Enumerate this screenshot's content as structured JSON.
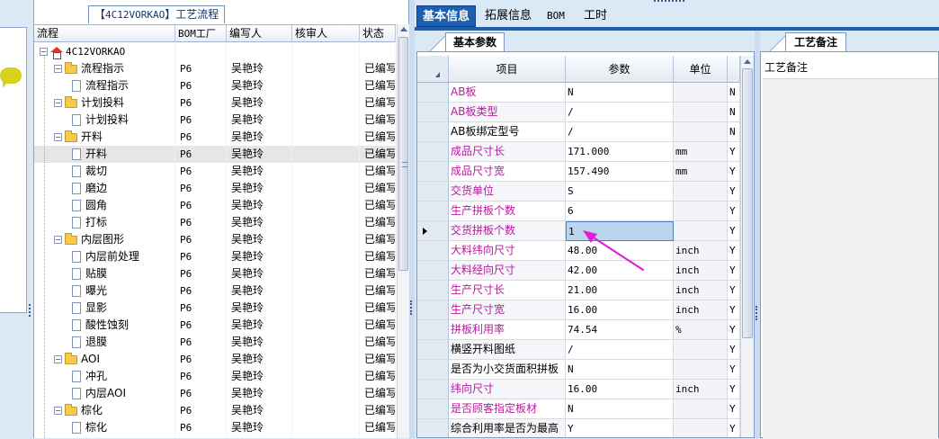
{
  "tree": {
    "title_prefix": "【",
    "title_code": "4C12VORKAO",
    "title_suffix": "】工艺流程",
    "headers": [
      "流程",
      "BOM工厂",
      "编写人",
      "核审人",
      "状态"
    ],
    "rows": [
      {
        "name": "4C12VORKAO",
        "level": 0,
        "kind": "root",
        "factory": "",
        "author": "",
        "reviewer": "",
        "status": ""
      },
      {
        "name": "流程指示",
        "level": 1,
        "kind": "folder",
        "factory": "P6",
        "author": "吴艳玲",
        "reviewer": "",
        "status": "已编写"
      },
      {
        "name": "流程指示",
        "level": 2,
        "kind": "doc",
        "factory": "P6",
        "author": "吴艳玲",
        "reviewer": "",
        "status": "已编写"
      },
      {
        "name": "计划投料",
        "level": 1,
        "kind": "folder",
        "factory": "P6",
        "author": "吴艳玲",
        "reviewer": "",
        "status": "已编写"
      },
      {
        "name": "计划投料",
        "level": 2,
        "kind": "doc",
        "factory": "P6",
        "author": "吴艳玲",
        "reviewer": "",
        "status": "已编写"
      },
      {
        "name": "开料",
        "level": 1,
        "kind": "folder",
        "factory": "P6",
        "author": "吴艳玲",
        "reviewer": "",
        "status": "已编写"
      },
      {
        "name": "开料",
        "level": 2,
        "kind": "doc",
        "factory": "P6",
        "author": "吴艳玲",
        "reviewer": "",
        "status": "已编写",
        "selected": true
      },
      {
        "name": "裁切",
        "level": 2,
        "kind": "doc",
        "factory": "P6",
        "author": "吴艳玲",
        "reviewer": "",
        "status": "已编写"
      },
      {
        "name": "磨边",
        "level": 2,
        "kind": "doc",
        "factory": "P6",
        "author": "吴艳玲",
        "reviewer": "",
        "status": "已编写"
      },
      {
        "name": "圆角",
        "level": 2,
        "kind": "doc",
        "factory": "P6",
        "author": "吴艳玲",
        "reviewer": "",
        "status": "已编写"
      },
      {
        "name": "打标",
        "level": 2,
        "kind": "doc",
        "factory": "P6",
        "author": "吴艳玲",
        "reviewer": "",
        "status": "已编写"
      },
      {
        "name": "内层图形",
        "level": 1,
        "kind": "folder",
        "factory": "P6",
        "author": "吴艳玲",
        "reviewer": "",
        "status": "已编写"
      },
      {
        "name": "内层前处理",
        "level": 2,
        "kind": "doc",
        "factory": "P6",
        "author": "吴艳玲",
        "reviewer": "",
        "status": "已编写"
      },
      {
        "name": "贴膜",
        "level": 2,
        "kind": "doc",
        "factory": "P6",
        "author": "吴艳玲",
        "reviewer": "",
        "status": "已编写"
      },
      {
        "name": "曝光",
        "level": 2,
        "kind": "doc",
        "factory": "P6",
        "author": "吴艳玲",
        "reviewer": "",
        "status": "已编写"
      },
      {
        "name": "显影",
        "level": 2,
        "kind": "doc",
        "factory": "P6",
        "author": "吴艳玲",
        "reviewer": "",
        "status": "已编写"
      },
      {
        "name": "酸性蚀刻",
        "level": 2,
        "kind": "doc",
        "factory": "P6",
        "author": "吴艳玲",
        "reviewer": "",
        "status": "已编写"
      },
      {
        "name": "退膜",
        "level": 2,
        "kind": "doc",
        "factory": "P6",
        "author": "吴艳玲",
        "reviewer": "",
        "status": "已编写"
      },
      {
        "name": "AOI",
        "level": 1,
        "kind": "folder",
        "factory": "P6",
        "author": "吴艳玲",
        "reviewer": "",
        "status": "已编写"
      },
      {
        "name": "冲孔",
        "level": 2,
        "kind": "doc",
        "factory": "P6",
        "author": "吴艳玲",
        "reviewer": "",
        "status": "已编写"
      },
      {
        "name": "内层AOI",
        "level": 2,
        "kind": "doc",
        "factory": "P6",
        "author": "吴艳玲",
        "reviewer": "",
        "status": "已编写"
      },
      {
        "name": "棕化",
        "level": 1,
        "kind": "folder",
        "factory": "P6",
        "author": "吴艳玲",
        "reviewer": "",
        "status": "已编写"
      },
      {
        "name": "棕化",
        "level": 2,
        "kind": "doc",
        "factory": "P6",
        "author": "吴艳玲",
        "reviewer": "",
        "status": "已编写"
      }
    ]
  },
  "top_tabs": [
    {
      "label": "基本信息",
      "active": true
    },
    {
      "label": "拓展信息",
      "active": false
    },
    {
      "label": "BOM",
      "active": false
    },
    {
      "label": "工时",
      "active": false
    }
  ],
  "params": {
    "tab_label": "基本参数",
    "headers": {
      "item": "项目",
      "param": "参数",
      "unit": "单位"
    },
    "rows": [
      {
        "item": "AB板",
        "value": "N",
        "unit": "",
        "flag": "N",
        "color": "magenta"
      },
      {
        "item": "AB板类型",
        "value": "/",
        "unit": "",
        "flag": "N",
        "color": "magenta"
      },
      {
        "item": "AB板绑定型号",
        "value": "/",
        "unit": "",
        "flag": "N",
        "color": "black"
      },
      {
        "item": "成品尺寸长",
        "value": "171.000",
        "unit": "mm",
        "flag": "Y",
        "color": "magenta"
      },
      {
        "item": "成品尺寸宽",
        "value": "157.490",
        "unit": "mm",
        "flag": "Y",
        "color": "magenta"
      },
      {
        "item": "交货单位",
        "value": "S",
        "unit": "",
        "flag": "Y",
        "color": "magenta"
      },
      {
        "item": "生产拼板个数",
        "value": "6",
        "unit": "",
        "flag": "Y",
        "color": "magenta"
      },
      {
        "item": "交货拼板个数",
        "value": "1",
        "unit": "",
        "flag": "Y",
        "color": "magenta",
        "current": true
      },
      {
        "item": "大料纬向尺寸",
        "value": "48.00",
        "unit": "inch",
        "flag": "Y",
        "color": "magenta"
      },
      {
        "item": "大料经向尺寸",
        "value": "42.00",
        "unit": "inch",
        "flag": "Y",
        "color": "magenta"
      },
      {
        "item": "生产尺寸长",
        "value": "21.00",
        "unit": "inch",
        "flag": "Y",
        "color": "magenta"
      },
      {
        "item": "生产尺寸宽",
        "value": "16.00",
        "unit": "inch",
        "flag": "Y",
        "color": "magenta"
      },
      {
        "item": "拼板利用率",
        "value": "74.54",
        "unit": "%",
        "flag": "Y",
        "color": "magenta"
      },
      {
        "item": "横竖开料图纸",
        "value": "/",
        "unit": "",
        "flag": "Y",
        "color": "black"
      },
      {
        "item": "是否为小交货面积拼板",
        "value": "N",
        "unit": "",
        "flag": "Y",
        "color": "black"
      },
      {
        "item": "纬向尺寸",
        "value": "16.00",
        "unit": "inch",
        "flag": "Y",
        "color": "magenta"
      },
      {
        "item": "是否顾客指定板材",
        "value": "N",
        "unit": "",
        "flag": "Y",
        "color": "magenta"
      },
      {
        "item": "综合利用率是否为最高",
        "value": "Y",
        "unit": "",
        "flag": "Y",
        "color": "black"
      }
    ]
  },
  "remarks": {
    "tab_label": "工艺备注",
    "label": "工艺备注"
  },
  "colors": {
    "accent": "#1d5fb0",
    "magenta_text": "#b31e9a",
    "annotation_arrow": "#e020d8"
  }
}
